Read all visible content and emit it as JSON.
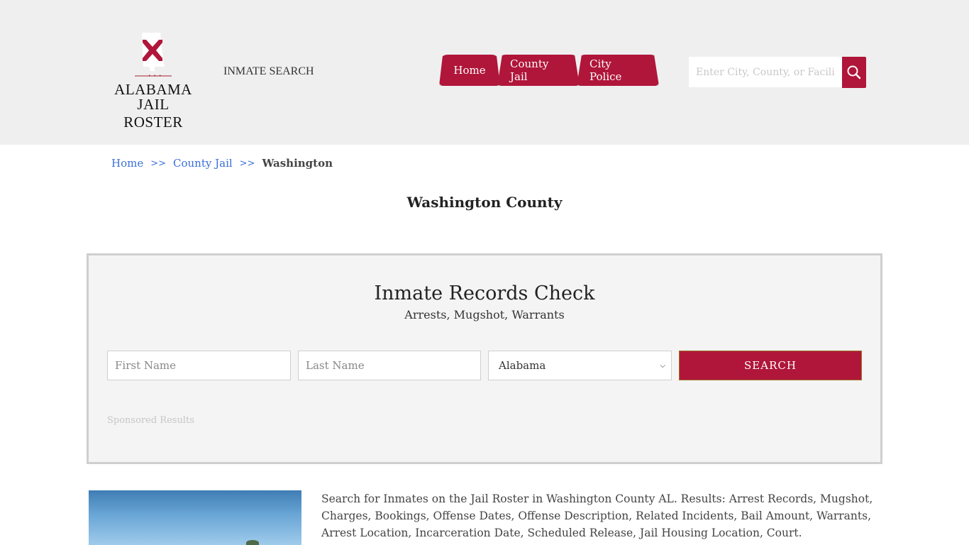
{
  "header": {
    "logo": {
      "line1": "ALABAMA",
      "line2": "JAIL ROSTER",
      "dots": "• • •"
    },
    "inmate_search_link": "INMATE SEARCH",
    "nav": [
      {
        "label": "Home"
      },
      {
        "label": "County Jail"
      },
      {
        "label": "City Police"
      }
    ],
    "site_search": {
      "placeholder": "Enter City, County, or Facility",
      "value": "",
      "icon": "search-icon"
    }
  },
  "breadcrumb": {
    "items": [
      {
        "label": "Home",
        "link": true
      },
      {
        "label": "County Jail",
        "link": true
      },
      {
        "label": "Washington",
        "link": false
      }
    ],
    "separator": ">>"
  },
  "page_title": "Washington County",
  "records_check": {
    "title": "Inmate Records Check",
    "subtitle": "Arrests, Mugshot, Warrants",
    "first_name": {
      "placeholder": "First Name",
      "value": ""
    },
    "last_name": {
      "placeholder": "Last Name",
      "value": ""
    },
    "state_select": {
      "selected": "Alabama"
    },
    "search_button": "SEARCH",
    "sponsored": "Sponsored Results"
  },
  "description": "Search for Inmates on the Jail Roster in Washington County AL. Results: Arrest Records, Mugshot, Charges, Bookings, Offense Dates, Offense Description, Related Incidents, Bail Amount, Warrants, Arrest Location, Incarceration Date, Scheduled Release, Jail Housing Location, Court.",
  "colors": {
    "brand": "#b0163a",
    "header_bg": "#efefef",
    "link": "#3a6fd8",
    "box_bg": "#f4f4f4"
  }
}
